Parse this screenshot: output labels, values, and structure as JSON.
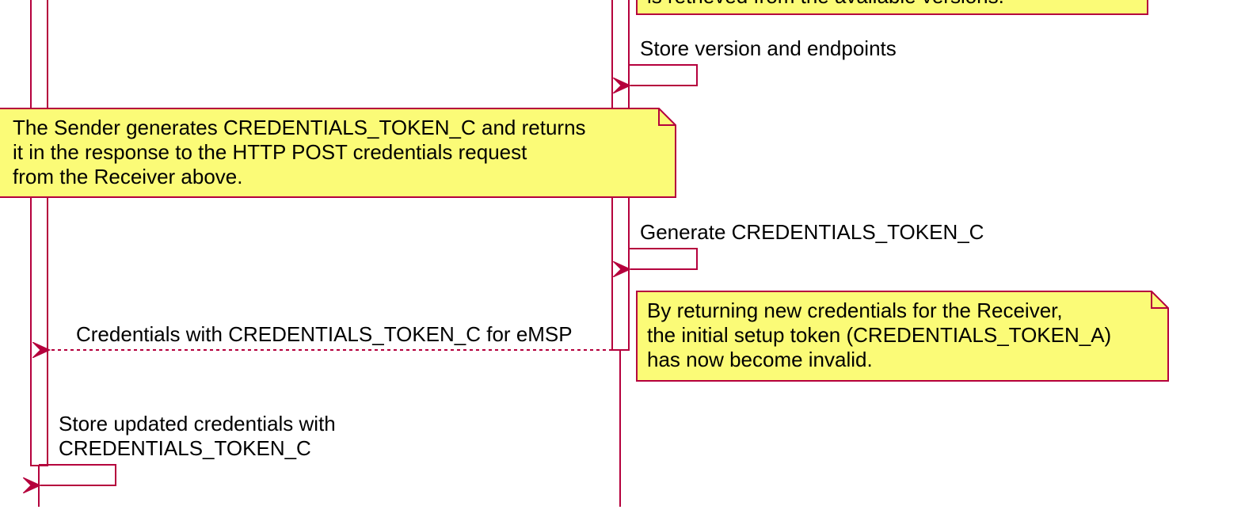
{
  "colors": {
    "line": "#b5003d",
    "note_fill": "#fbfb77",
    "activation_fill": "#ffffff",
    "text": "#000000"
  },
  "notes": {
    "top_partial": "is retrieved from the available versions.",
    "sender_generates": [
      "The Sender generates CREDENTIALS_TOKEN_C and returns",
      "it in the response to the HTTP POST credentials request",
      "from the Receiver above."
    ],
    "returning_credentials": [
      "By returning new credentials for the Receiver,",
      "the initial setup token (CREDENTIALS_TOKEN_A)",
      "has now become invalid."
    ]
  },
  "messages": {
    "store_version": "Store version and endpoints",
    "generate_token": "Generate CREDENTIALS_TOKEN_C",
    "credentials_response": "Credentials with CREDENTIALS_TOKEN_C for eMSP",
    "store_updated": [
      "Store updated credentials with",
      "CREDENTIALS_TOKEN_C"
    ]
  }
}
